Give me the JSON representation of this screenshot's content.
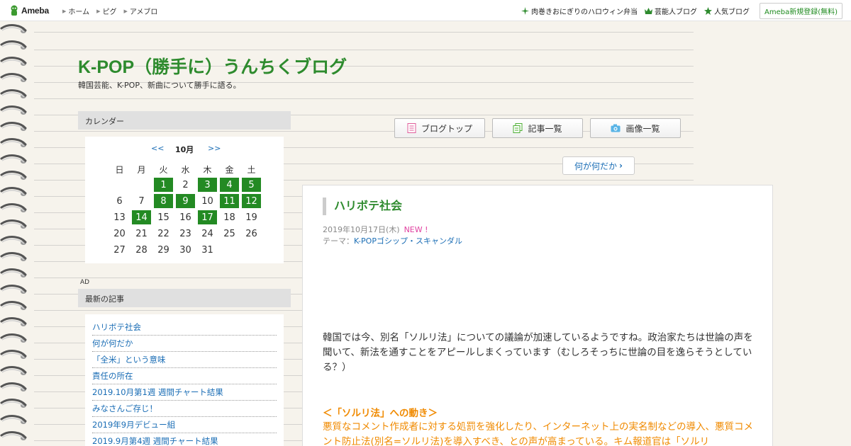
{
  "header": {
    "logo_text": "Ameba",
    "nav": [
      "ホーム",
      "ピグ",
      "アメブロ"
    ],
    "right_links": [
      {
        "label": "肉巻きおにぎりのハロウィン弁当",
        "icon": "sparkle-icon"
      },
      {
        "label": "芸能人ブログ",
        "icon": "crown-icon"
      },
      {
        "label": "人気ブログ",
        "icon": "star-icon"
      }
    ],
    "register_label": "Ameba新規登録(無料)"
  },
  "blog": {
    "title": "K-POP（勝手に）うんちくブログ",
    "description": "韓国芸能、K-POP、新曲について勝手に語る。"
  },
  "calendar": {
    "heading": "カレンダー",
    "prev": "<<",
    "month": "10月",
    "next": ">>",
    "weekdays": [
      "日",
      "月",
      "火",
      "水",
      "木",
      "金",
      "土"
    ],
    "weeks": [
      [
        "",
        "",
        "1",
        "2",
        "3",
        "4",
        "5"
      ],
      [
        "6",
        "7",
        "8",
        "9",
        "10",
        "11",
        "12"
      ],
      [
        "13",
        "14",
        "15",
        "16",
        "17",
        "18",
        "19"
      ],
      [
        "20",
        "21",
        "22",
        "23",
        "24",
        "25",
        "26"
      ],
      [
        "27",
        "28",
        "29",
        "30",
        "31",
        "",
        ""
      ]
    ],
    "linked_days": [
      "1",
      "3",
      "4",
      "5",
      "8",
      "9",
      "11",
      "12",
      "14",
      "17"
    ]
  },
  "ad_label": "AD",
  "latest": {
    "heading": "最新の記事",
    "items": [
      "ハリボテ社会",
      "何が何だか",
      "「全米」という意味",
      "責任の所在",
      "2019.10月第1週 週間チャート結果",
      "みなさんご存じ！",
      "2019年9月デビュー組",
      "2019.9月第4週 週間チャート結果"
    ]
  },
  "nav_buttons": {
    "top": "ブログトップ",
    "list": "記事一覧",
    "images": "画像一覧"
  },
  "prev_article": "何が何だか",
  "article": {
    "title": "ハリボテ社会",
    "date": "2019年10月17日(木)",
    "new_badge": "NEW !",
    "theme_label": "テーマ：",
    "theme": "K-POPゴシップ・スキャンダル",
    "paragraph1": "韓国では今、別名「ソルリ法」についての議論が加速しているようですね。政治家たちは世論の声を聞いて、新法を通すことをアピールしまくっています（むしろそっちに世論の目を逸らそうとしている？）",
    "subheading": "＜「ソルリ法」への動き＞",
    "paragraph2": "悪質なコメント作成者に対する処罰を強化したり、インターネット上の実名制などの導入、悪質コメント防止法(別名=ソルリ法)を導入すべき、との声が高まっている。キム報道官は「ソルリ"
  },
  "colors": {
    "accent_green": "#2e8b2e",
    "calendar_active": "#238a23",
    "link_blue": "#1a6db5",
    "subheading_orange": "#f08a00",
    "new_pink": "#e040a0"
  }
}
